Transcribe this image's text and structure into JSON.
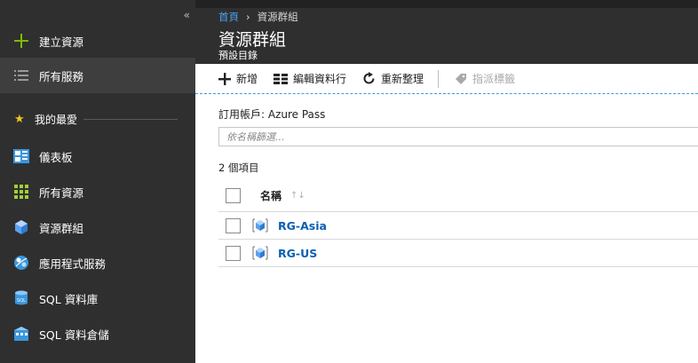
{
  "sidebar": {
    "collapse_glyph": "«",
    "items": [
      {
        "label": "建立資源",
        "icon": "plus-icon"
      },
      {
        "label": "所有服務",
        "icon": "list-icon"
      }
    ],
    "favorites_label": "我的最愛",
    "favorites": [
      {
        "label": "儀表板",
        "icon": "dashboard-icon"
      },
      {
        "label": "所有資源",
        "icon": "grid-icon"
      },
      {
        "label": "資源群組",
        "icon": "cube-icon"
      },
      {
        "label": "應用程式服務",
        "icon": "app-service-icon"
      },
      {
        "label": "SQL 資料庫",
        "icon": "sql-database-icon"
      },
      {
        "label": "SQL 資料倉儲",
        "icon": "sql-warehouse-icon"
      }
    ]
  },
  "header": {
    "breadcrumb_home": "首頁",
    "breadcrumb_sep": "›",
    "breadcrumb_current": "資源群組",
    "title": "資源群組",
    "subtitle": "預設目錄"
  },
  "toolbar": {
    "add": "新增",
    "edit_columns": "編輯資料行",
    "refresh": "重新整理",
    "assign_tags": "指派標籤"
  },
  "main": {
    "subscription_key": "訂用帳戶:",
    "subscription_value": "Azure Pass",
    "filter_placeholder": "依名稱篩選...",
    "count": "2 個項目",
    "column_name": "名稱",
    "sort_glyph": "↑↓",
    "rows": [
      {
        "name": "RG-Asia"
      },
      {
        "name": "RG-US"
      }
    ]
  },
  "colors": {
    "sidebar_bg": "#2f2f2f",
    "active_bg": "#3e3e3e",
    "link": "#0a5fb4",
    "breadcrumb_link": "#4aa3f0",
    "star": "#f0c419"
  }
}
